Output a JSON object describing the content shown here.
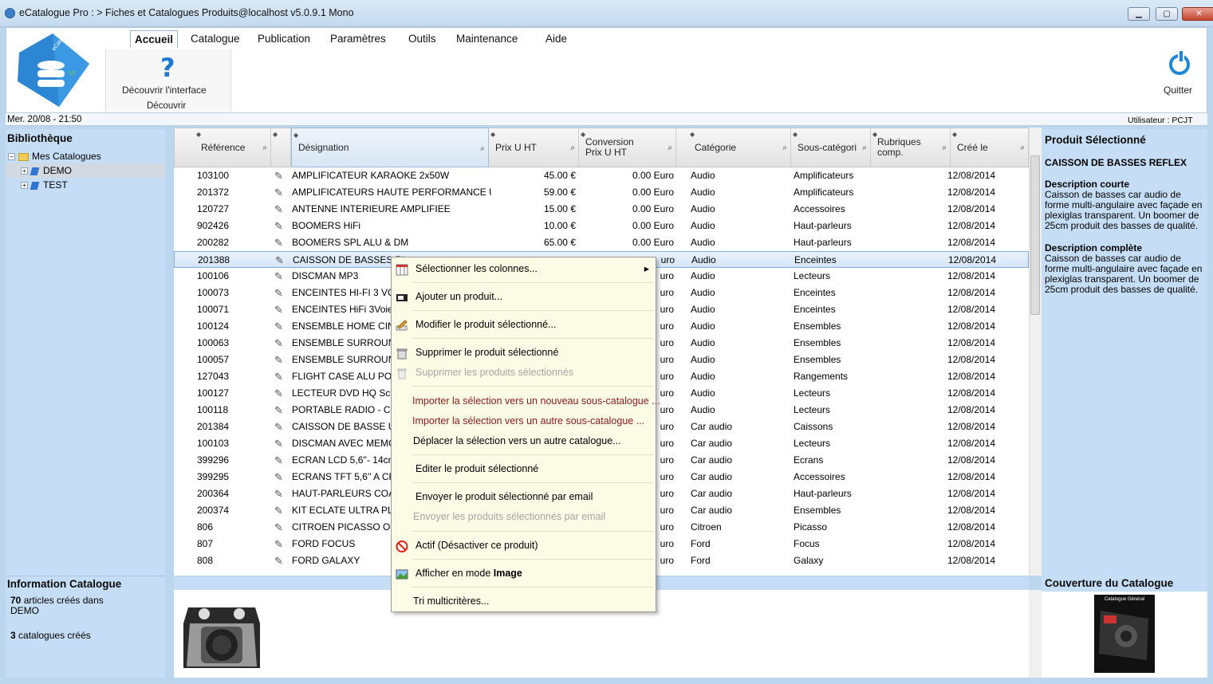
{
  "window": {
    "title": "eCatalogue Pro : > Fiches et Catalogues Produits@localhost v5.0.9.1 Mono",
    "buttons": {
      "minimize": "▁",
      "maximize": "▢",
      "close": "✕"
    }
  },
  "logo": {
    "text": "eCatalogue Pro",
    "version": "V5"
  },
  "menu": {
    "tabs": [
      "Accueil",
      "Catalogue",
      "Publication",
      "Paramètres",
      "Outils",
      "Maintenance",
      "Aide"
    ]
  },
  "ribbon": {
    "discover_button": "Découvrir l'interface",
    "group_label": "Découvrir",
    "help_glyph": "?",
    "quit_button": "Quitter"
  },
  "status": {
    "date": "Mer. 20/08 - 21:50",
    "user": "Utilisateur : PCJT"
  },
  "library": {
    "title": "Bibliothèque",
    "root": "Mes Catalogues",
    "items": [
      "DEMO",
      "TEST"
    ],
    "expander_root": "−",
    "expander_child": "+"
  },
  "info": {
    "title": "Information Catalogue",
    "count": "70",
    "articles_text": "articles créés dans",
    "catalog_name": "DEMO",
    "cat_count": "3",
    "cat_text": "catalogues créés"
  },
  "grid": {
    "columns": [
      {
        "label": "Référence"
      },
      {
        "label": ""
      },
      {
        "label": "Désignation"
      },
      {
        "label": "Prix U HT"
      },
      {
        "label": "Conversion\nPrix U HT"
      },
      {
        "label": "Catégorie"
      },
      {
        "label": "Sous-catégori"
      },
      {
        "label": "Rubriques\ncomp."
      },
      {
        "label": "Créé le"
      }
    ],
    "sort_glyph": "◆",
    "filter_glyph": "⌕",
    "rows": [
      {
        "ref": "103100",
        "name": "AMPLIFICATEUR KARAOKE 2x50W",
        "price": "45.00 €",
        "conv": "0.00 Euro",
        "cat": "Audio",
        "sub": "Amplificateurs",
        "date": "12/08/2014"
      },
      {
        "ref": "201372",
        "name": "AMPLIFICATEURS HAUTE PERFORMANCE US",
        "price": "59.00 €",
        "conv": "0.00 Euro",
        "cat": "Audio",
        "sub": "Amplificateurs",
        "date": "12/08/2014"
      },
      {
        "ref": "120727",
        "name": "ANTENNE INTERIEURE AMPLIFIEE",
        "price": "15.00 €",
        "conv": "0.00 Euro",
        "cat": "Audio",
        "sub": "Accessoires",
        "date": "12/08/2014"
      },
      {
        "ref": "902426",
        "name": "BOOMERS HiFi",
        "price": "10.00 €",
        "conv": "0.00 Euro",
        "cat": "Audio",
        "sub": "Haut-parleurs",
        "date": "12/08/2014"
      },
      {
        "ref": "200282",
        "name": "BOOMERS SPL ALU & DM",
        "price": "65.00 €",
        "conv": "0.00 Euro",
        "cat": "Audio",
        "sub": "Haut-parleurs",
        "date": "12/08/2014"
      },
      {
        "ref": "201388",
        "name": "CAISSON DE BASSES RI",
        "price": "",
        "conv": "uro",
        "cat": "Audio",
        "sub": "Enceintes",
        "date": "12/08/2014"
      },
      {
        "ref": "100106",
        "name": "DISCMAN MP3",
        "price": "",
        "conv": "uro",
        "cat": "Audio",
        "sub": "Lecteurs",
        "date": "12/08/2014"
      },
      {
        "ref": "100073",
        "name": "ENCEINTES HI-FI 3 VOIE",
        "price": "",
        "conv": "uro",
        "cat": "Audio",
        "sub": "Enceintes",
        "date": "12/08/2014"
      },
      {
        "ref": "100071",
        "name": "ENCEINTES HiFi 3Voies",
        "price": "",
        "conv": "uro",
        "cat": "Audio",
        "sub": "Enceintes",
        "date": "12/08/2014"
      },
      {
        "ref": "100124",
        "name": "ENSEMBLE HOME CINE",
        "price": "",
        "conv": "uro",
        "cat": "Audio",
        "sub": "Ensembles",
        "date": "12/08/2014"
      },
      {
        "ref": "100063",
        "name": "ENSEMBLE SURROUND",
        "price": "",
        "conv": "uro",
        "cat": "Audio",
        "sub": "Ensembles",
        "date": "12/08/2014"
      },
      {
        "ref": "100057",
        "name": "ENSEMBLE SURROUND",
        "price": "",
        "conv": "uro",
        "cat": "Audio",
        "sub": "Ensembles",
        "date": "12/08/2014"
      },
      {
        "ref": "127043",
        "name": "FLIGHT CASE ALU POUF",
        "price": "",
        "conv": "uro",
        "cat": "Audio",
        "sub": "Rangements",
        "date": "12/08/2014"
      },
      {
        "ref": "100127",
        "name": "LECTEUR DVD HQ Scan",
        "price": "",
        "conv": "uro",
        "cat": "Audio",
        "sub": "Lecteurs",
        "date": "12/08/2014"
      },
      {
        "ref": "100118",
        "name": "PORTABLE RADIO - CD S",
        "price": "",
        "conv": "uro",
        "cat": "Audio",
        "sub": "Lecteurs",
        "date": "12/08/2014"
      },
      {
        "ref": "201384",
        "name": "CAISSON DE BASSE USI",
        "price": "",
        "conv": "uro",
        "cat": "Car audio",
        "sub": "Caissons",
        "date": "12/08/2014"
      },
      {
        "ref": "100103",
        "name": "DISCMAN AVEC MEMOIF",
        "price": "",
        "conv": "uro",
        "cat": "Car audio",
        "sub": "Lecteurs",
        "date": "12/08/2014"
      },
      {
        "ref": "399296",
        "name": "ECRAN LCD 5,6''- 14cm",
        "price": "",
        "conv": "uro",
        "cat": "Car audio",
        "sub": "Ecrans",
        "date": "12/08/2014"
      },
      {
        "ref": "399295",
        "name": "ECRANS TFT 5,6'' A CRI",
        "price": "",
        "conv": "uro",
        "cat": "Car audio",
        "sub": "Accessoires",
        "date": "12/08/2014"
      },
      {
        "ref": "200364",
        "name": "HAUT-PARLEURS COAX",
        "price": "",
        "conv": "uro",
        "cat": "Car audio",
        "sub": "Haut-parleurs",
        "date": "12/08/2014"
      },
      {
        "ref": "200374",
        "name": "KIT ECLATE ULTRA PLA",
        "price": "",
        "conv": "uro",
        "cat": "Car audio",
        "sub": "Ensembles",
        "date": "12/08/2014"
      },
      {
        "ref": "806",
        "name": "CITROEN PICASSO OR",
        "price": "",
        "conv": "uro",
        "cat": "Citroen",
        "sub": "Picasso",
        "date": "12/08/2014"
      },
      {
        "ref": "807",
        "name": "FORD FOCUS",
        "price": "",
        "conv": "uro",
        "cat": "Ford",
        "sub": "Focus",
        "date": "12/08/2014"
      },
      {
        "ref": "808",
        "name": "FORD GALAXY",
        "price": "",
        "conv": "uro",
        "cat": "Ford",
        "sub": "Galaxy",
        "date": "12/08/2014"
      }
    ],
    "attach_glyph": "✎"
  },
  "context_menu": {
    "items": [
      {
        "label": "Sélectionner les colonnes...",
        "icon": "columns-icon",
        "style": "normal",
        "arrow": "▸"
      },
      {
        "label": "Ajouter un produit...",
        "icon": "add-product-icon",
        "style": "normal"
      },
      {
        "label": "Modifier le produit sélectionné...",
        "icon": "edit-icon",
        "style": "normal"
      },
      {
        "label": "Supprimer le produit sélectionné",
        "icon": "trash-icon",
        "style": "normal"
      },
      {
        "label": "Supprimer les produits sélectionnés",
        "icon": "trash-disabled-icon",
        "style": "disabled"
      },
      {
        "label": "Importer la sélection vers un nouveau sous-catalogue ...",
        "icon": "",
        "style": "red"
      },
      {
        "label": "Importer la sélection vers un autre sous-catalogue ...",
        "icon": "",
        "style": "red"
      },
      {
        "label": "Déplacer la sélection vers un autre catalogue...",
        "icon": "",
        "style": "plain"
      },
      {
        "label": "Editer le produit sélectionné",
        "icon": "",
        "style": "normal"
      },
      {
        "label": "Envoyer le produit sélectionné par email",
        "icon": "",
        "style": "normal"
      },
      {
        "label": "Envoyer les produits sélectionnés par email",
        "icon": "",
        "style": "disabled-plain"
      },
      {
        "label": "Actif (Désactiver ce produit)",
        "icon": "no-entry-icon",
        "style": "normal"
      },
      {
        "label_pre": "Afficher  en mode ",
        "label_bold": "Image",
        "icon": "image-icon",
        "style": "normal"
      },
      {
        "label": "Tri multicritères...",
        "icon": "",
        "style": "plain"
      }
    ]
  },
  "selected_product": {
    "panel_title": "Produit Sélectionné",
    "name": "CAISSON DE BASSES REFLEX",
    "short_title": "Description courte",
    "short_text": "Caisson de basses car audio de forme multi-angulaire avec façade en plexiglas transparent. Un boomer de 25cm produit des basses de qualité.",
    "full_title": "Description complète",
    "full_text": "Caisson de basses car audio de forme multi-angulaire avec façade en plexiglas transparent. Un boomer de 25cm produit des basses de qualité."
  },
  "cover": {
    "title": "Couverture du Catalogue",
    "cover_text": "Catalogue Général"
  },
  "colors": {
    "panel_bg": "#c6def5",
    "menu_bg": "#fcfbe6",
    "accent": "#1e88d8",
    "red_item": "#8a1a1a"
  }
}
